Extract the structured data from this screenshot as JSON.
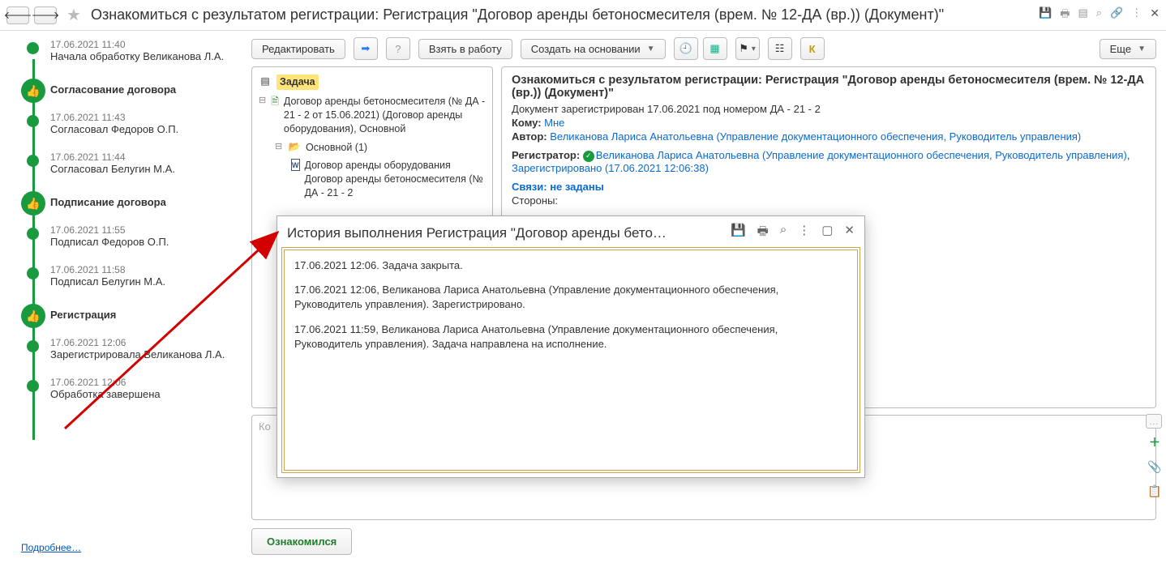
{
  "header": {
    "title": "Ознакомиться с результатом регистрации: Регистрация \"Договор аренды бетоносмесителя (врем. № 12-ДА (вр.)) (Документ)\""
  },
  "toolbar": {
    "edit": "Редактировать",
    "take": "Взять в работу",
    "create": "Создать на основании",
    "more": "Еще"
  },
  "timeline": [
    {
      "time": "17.06.2021 11:40",
      "text": "Начала обработку Великанова Л.А."
    },
    {
      "head": "Согласование договора"
    },
    {
      "time": "17.06.2021 11:43",
      "text": "Согласовал Федоров О.П."
    },
    {
      "time": "17.06.2021 11:44",
      "text": "Согласовал Белугин М.А."
    },
    {
      "head": "Подписание договора"
    },
    {
      "time": "17.06.2021 11:55",
      "text": "Подписал Федоров О.П."
    },
    {
      "time": "17.06.2021 11:58",
      "text": "Подписал Белугин М.А."
    },
    {
      "head": "Регистрация"
    },
    {
      "time": "17.06.2021 12:06",
      "text": "Зарегистрировала Великанова Л.А."
    },
    {
      "time": "17.06.2021 12:06",
      "text": "Обработка завершена"
    }
  ],
  "more_link": "Подробнее…",
  "tree": {
    "task": "Задача",
    "doc": "Договор аренды бетоносмесителя (№ ДА - 21 - 2 от 15.06.2021) (Договор аренды оборудования), Основной",
    "folder": "Основной (1)",
    "file": "Договор аренды оборудования Договор аренды бетоносмесителя (№ ДА - 21 - 2"
  },
  "info": {
    "title": "Ознакомиться с результатом регистрации: Регистрация \"Договор аренды бетоносмесителя (врем. № 12-ДА (вр.)) (Документ)\"",
    "registered": "Документ зарегистрирован 17.06.2021 под номером ДА - 21 - 2",
    "to_label": "Кому:",
    "to": "Мне",
    "author_label": "Автор:",
    "author": "Великанова Лариса Анатольевна (Управление документационного обеспечения, Руководитель управления)",
    "registrar_label": "Регистратор:",
    "registrar": "Великанова Лариса Анатольевна (Управление документационного обеспечения, Руководитель управления)",
    "registered_link": "Зарегистрировано (17.06.2021 12:06:38)",
    "links_label": "Связи: не заданы",
    "parties": "Стороны:"
  },
  "comment_placeholder": "Ко",
  "modal": {
    "title": "История выполнения Регистрация \"Договор аренды бето…",
    "entries": [
      "17.06.2021 12:06. Задача закрыта.",
      "17.06.2021 12:06, Великанова Лариса Анатольевна (Управление документационного обеспечения, Руководитель управления). Зарегистрировано.",
      "17.06.2021 11:59, Великанова Лариса Анатольевна (Управление документационного обеспечения, Руководитель управления). Задача направлена на исполнение."
    ]
  },
  "footer_btn": "Ознакомился"
}
